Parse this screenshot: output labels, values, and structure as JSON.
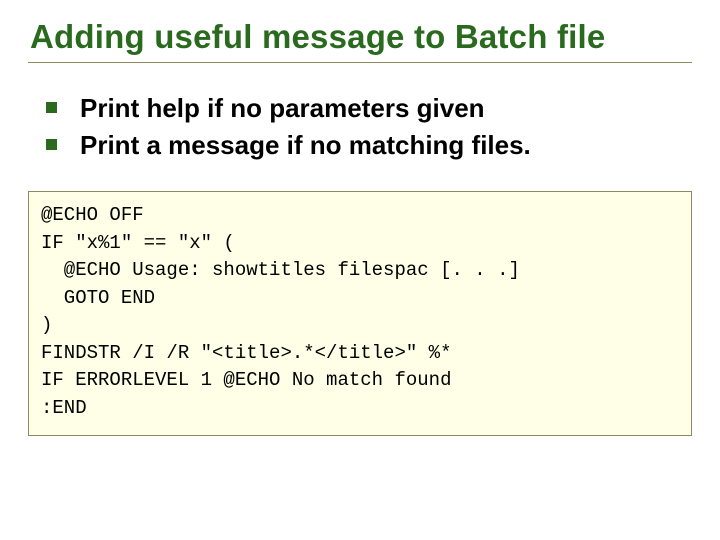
{
  "title": "Adding useful message to Batch file",
  "bullets": [
    "Print help if no parameters given",
    "Print a message if no matching files."
  ],
  "code": {
    "line1": "@ECHO OFF",
    "line2": "IF \"x%1\" == \"x\" (",
    "line3": "  @ECHO Usage: showtitles filespac [. . .]",
    "line4": "  GOTO END",
    "line5": ")",
    "line6": "FINDSTR /I /R \"<title>.*</title>\" %*",
    "line7": "IF ERRORLEVEL 1 @ECHO No match found",
    "line8": ":END"
  }
}
